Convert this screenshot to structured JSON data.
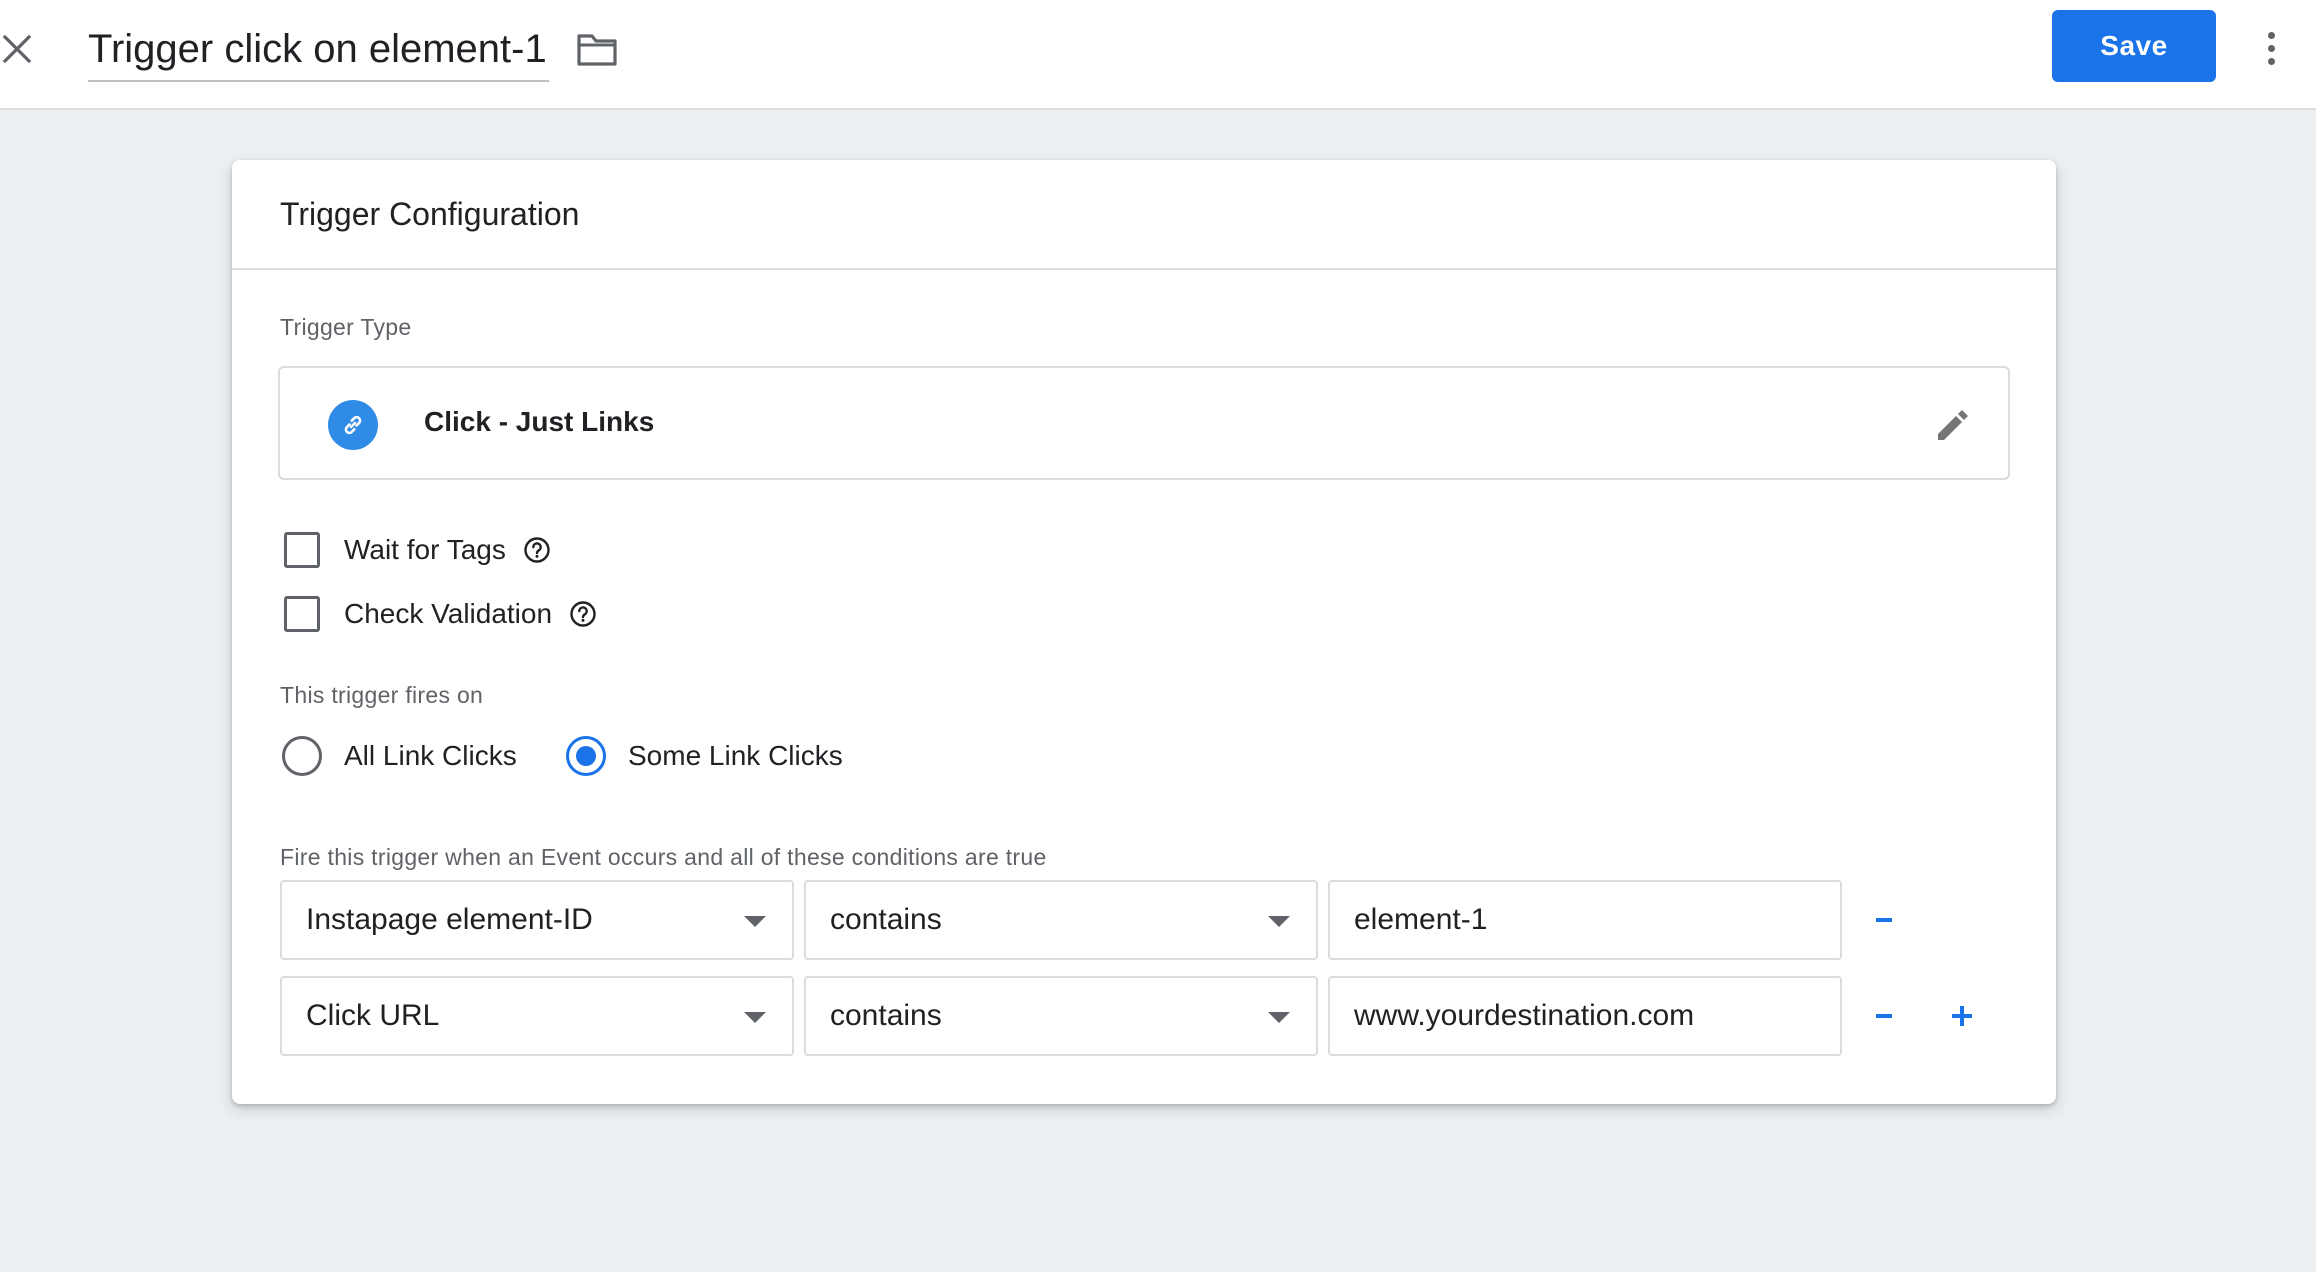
{
  "header": {
    "title": "Trigger click on element-1",
    "save_label": "Save"
  },
  "card": {
    "title": "Trigger Configuration",
    "trigger_type_label": "Trigger Type",
    "trigger_type": {
      "name": "Click - Just Links",
      "icon": "link-icon"
    },
    "options": [
      {
        "label": "Wait for Tags",
        "checked": false
      },
      {
        "label": "Check Validation",
        "checked": false
      }
    ],
    "fires_on_label": "This trigger fires on",
    "fires_on_options": [
      {
        "label": "All Link Clicks",
        "selected": false
      },
      {
        "label": "Some Link Clicks",
        "selected": true
      }
    ],
    "conditions_label": "Fire this trigger when an Event occurs and all of these conditions are true",
    "conditions": [
      {
        "variable": "Instapage element-ID",
        "operator": "contains",
        "value": "element-1"
      },
      {
        "variable": "Click URL",
        "operator": "contains",
        "value": "www.yourdestination.com"
      }
    ]
  },
  "colors": {
    "accent": "#1a73e8",
    "link_badge": "#2f8be6",
    "background": "#eceff1"
  }
}
